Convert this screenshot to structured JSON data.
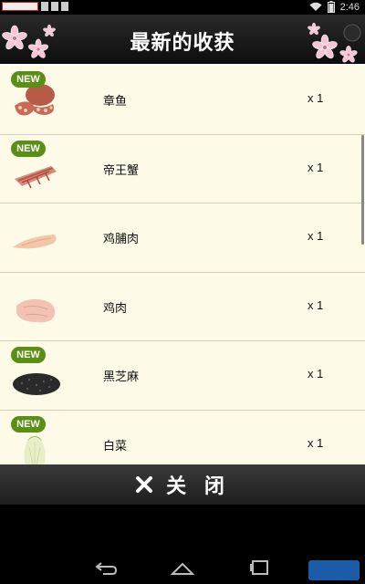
{
  "status_bar": {
    "time": "2:46",
    "wifi_icon": "wifi-icon",
    "battery_icon": "battery-icon"
  },
  "header": {
    "title": "最新的收获"
  },
  "items": [
    {
      "name": "章鱼",
      "qty": "x 1",
      "badge": "NEW",
      "is_new": true,
      "icon": "octopus-image"
    },
    {
      "name": "帝王蟹",
      "qty": "x 1",
      "badge": "NEW",
      "is_new": true,
      "icon": "king-crab-image"
    },
    {
      "name": "鸡脯肉",
      "qty": "x 1",
      "badge": "",
      "is_new": false,
      "icon": "chicken-breast-image"
    },
    {
      "name": "鸡肉",
      "qty": "x 1",
      "badge": "",
      "is_new": false,
      "icon": "chicken-image"
    },
    {
      "name": "黑芝麻",
      "qty": "x 1",
      "badge": "NEW",
      "is_new": true,
      "icon": "black-sesame-image"
    },
    {
      "name": "白菜",
      "qty": "x 1",
      "badge": "NEW",
      "is_new": true,
      "icon": "cabbage-image"
    }
  ],
  "close_button": {
    "icon": "close-icon",
    "label": "关 闭"
  },
  "nav_bar": {
    "back_icon": "back-icon",
    "home_icon": "home-icon",
    "recents_icon": "recents-icon"
  },
  "colors": {
    "badge_green": "#5a8e14",
    "list_bg": "#fdfbe8",
    "header_bg": "#1a1a1a"
  }
}
